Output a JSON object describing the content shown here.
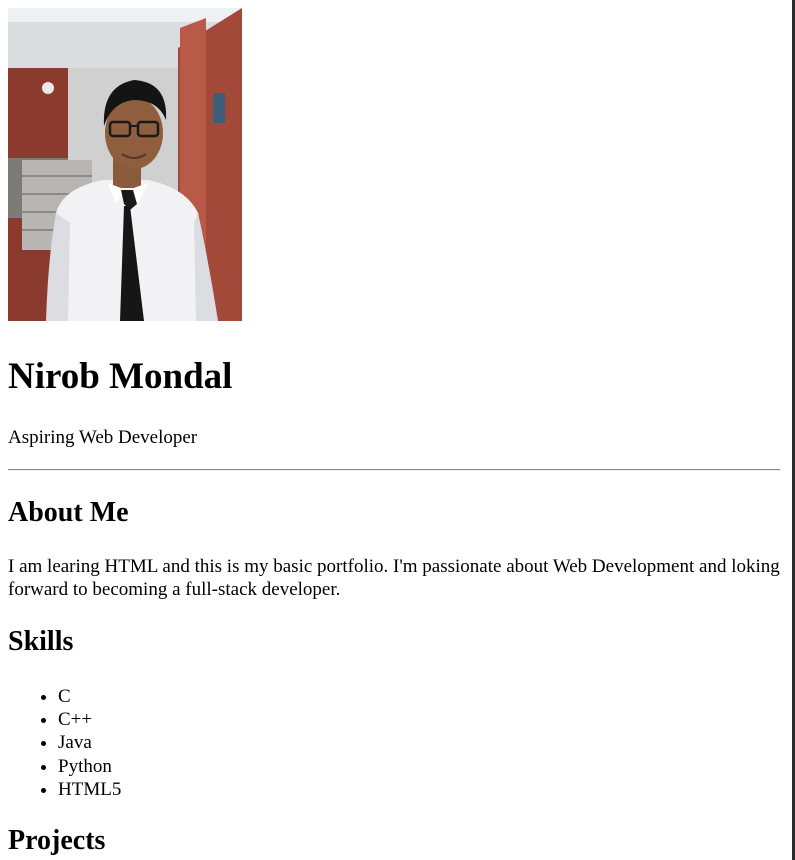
{
  "profile": {
    "name": "Nirob Mondal",
    "tagline": "Aspiring Web Developer"
  },
  "about": {
    "heading": "About Me",
    "text": "I am learing HTML and this is my basic portfolio. I'm passionate about Web Development and loking forward to becoming a full-stack developer."
  },
  "skills": {
    "heading": "Skills",
    "items": [
      "C",
      "C++",
      "Java",
      "Python",
      "HTML5"
    ]
  },
  "projects": {
    "heading": "Projects"
  }
}
